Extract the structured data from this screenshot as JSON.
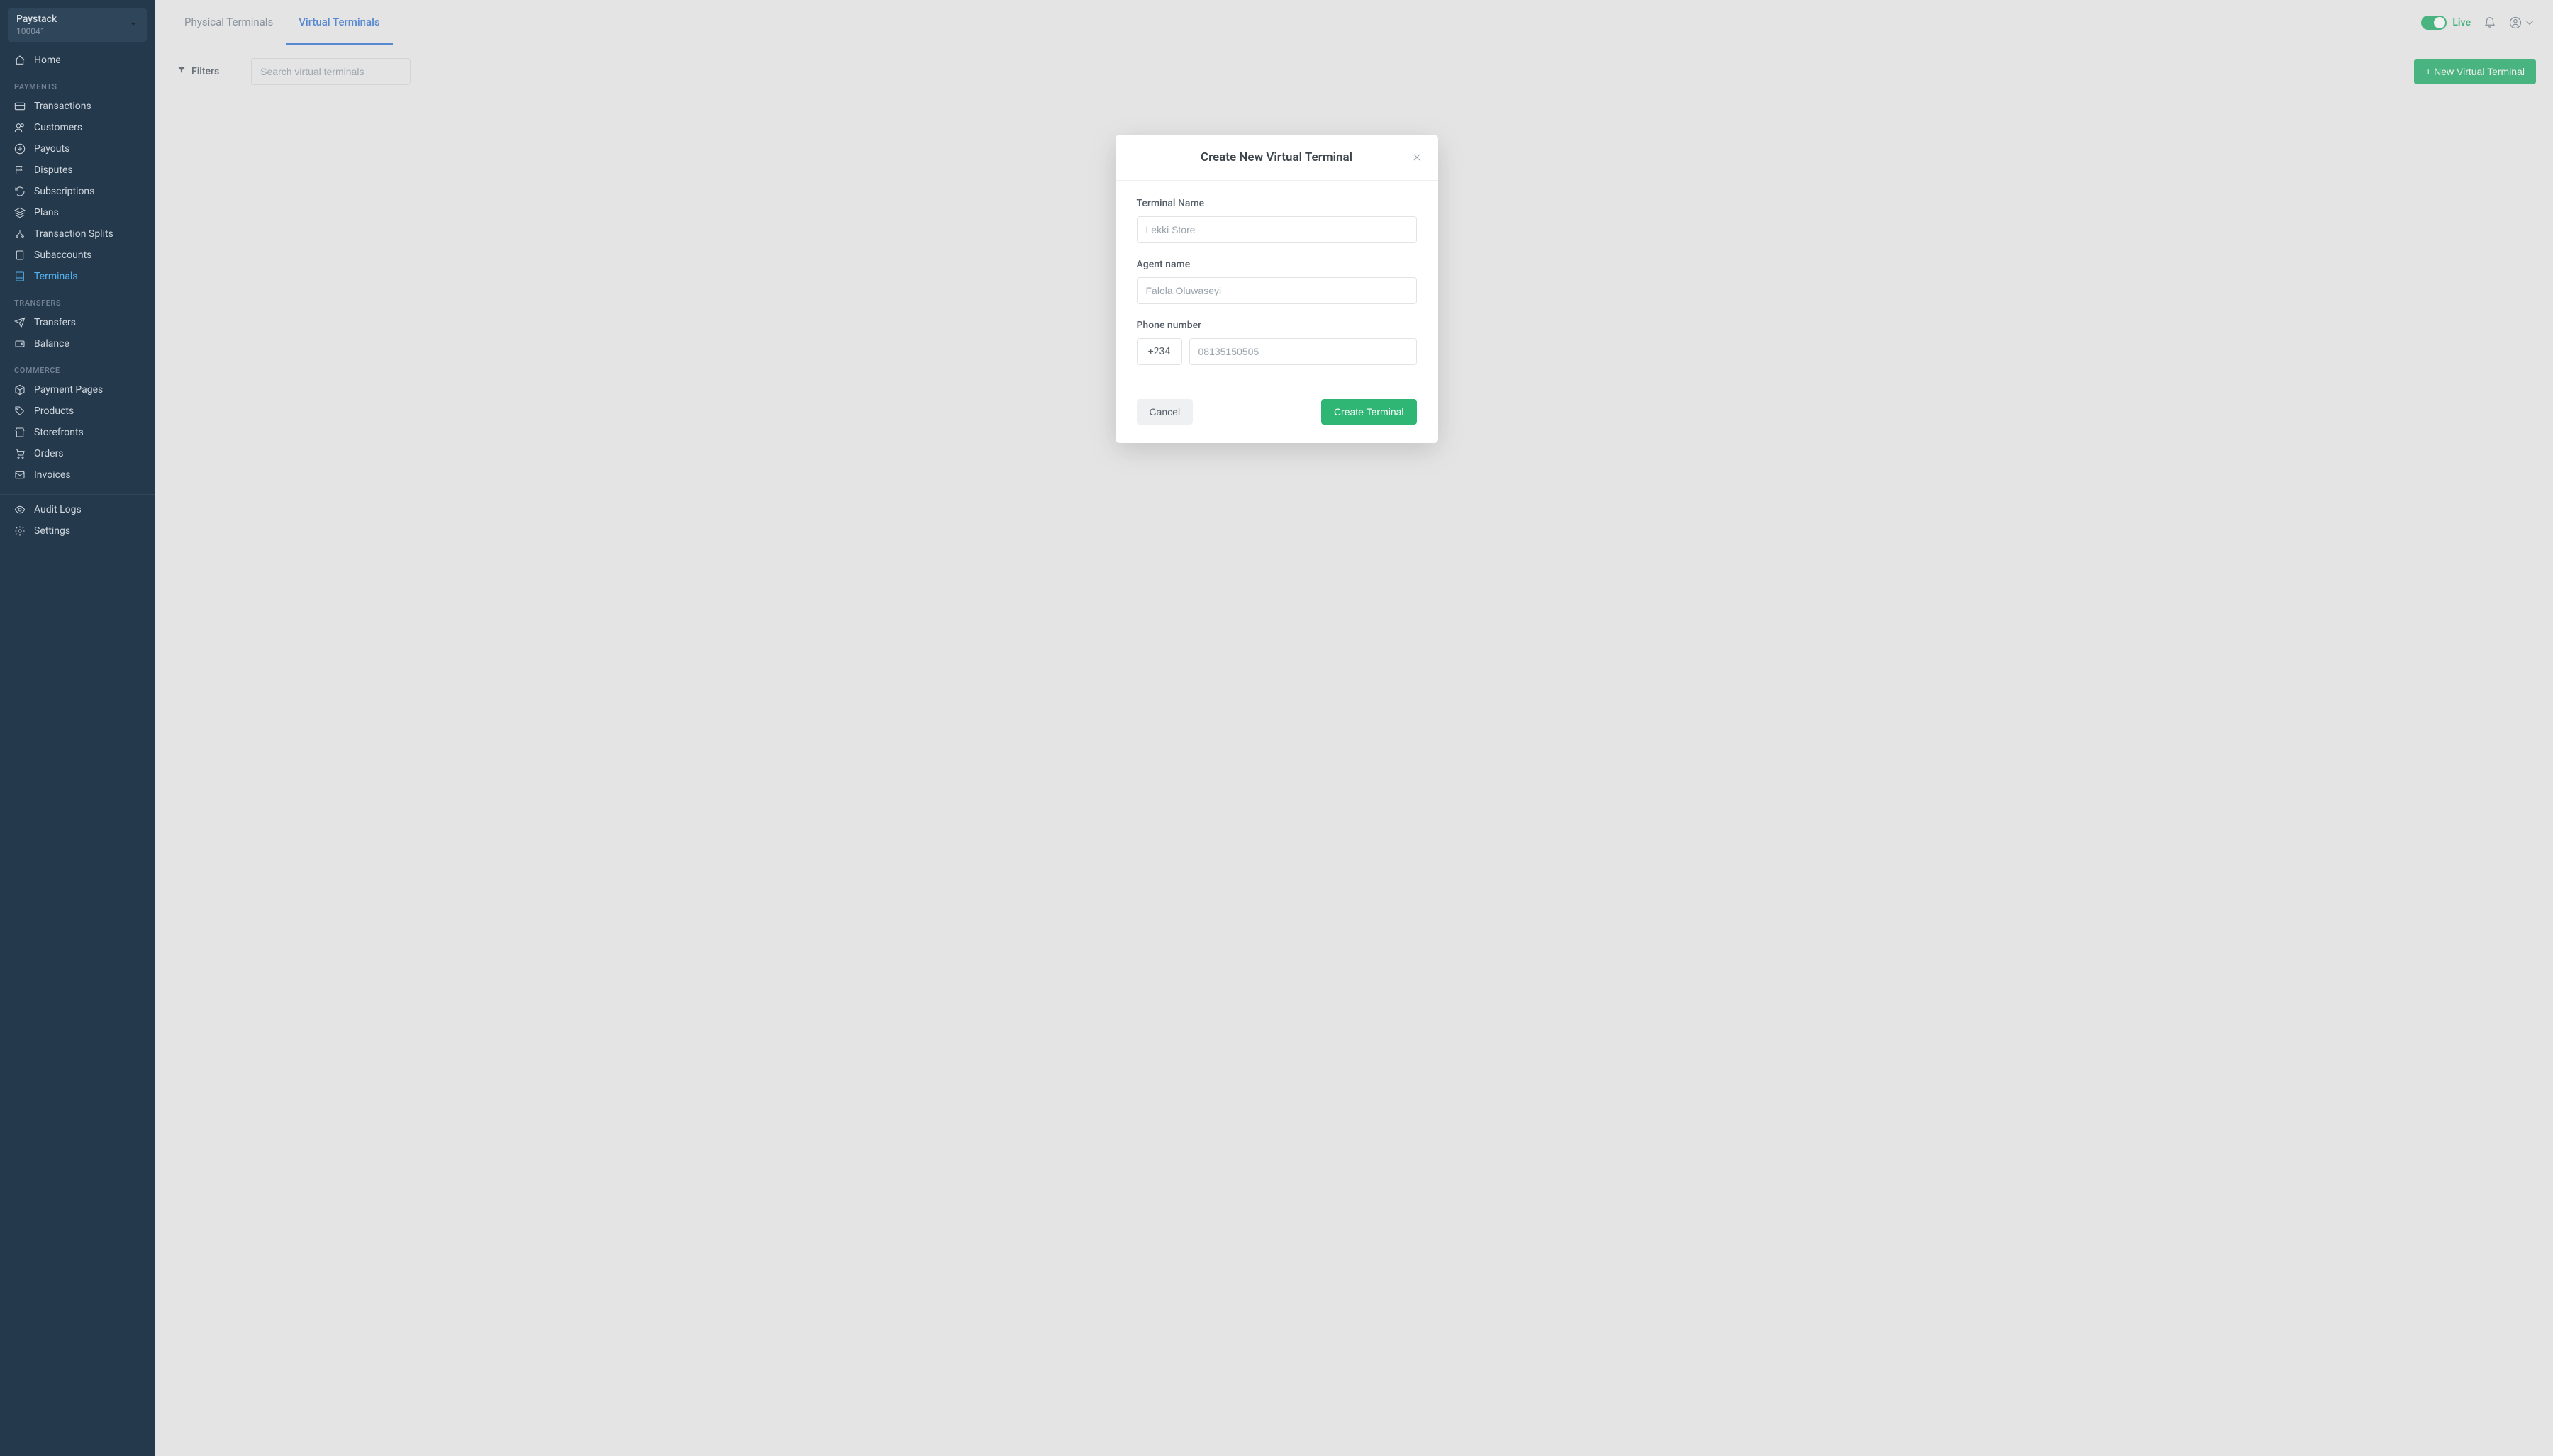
{
  "sidebar": {
    "org_name": "Paystack",
    "org_id": "100041",
    "home_label": "Home",
    "section_payments": "PAYMENTS",
    "section_transfers": "TRANSFERS",
    "section_commerce": "COMMERCE",
    "items": {
      "transactions": "Transactions",
      "customers": "Customers",
      "payouts": "Payouts",
      "disputes": "Disputes",
      "subscriptions": "Subscriptions",
      "plans": "Plans",
      "transaction_splits": "Transaction Splits",
      "subaccounts": "Subaccounts",
      "terminals": "Terminals",
      "transfers": "Transfers",
      "balance": "Balance",
      "payment_pages": "Payment Pages",
      "products": "Products",
      "storefronts": "Storefronts",
      "orders": "Orders",
      "invoices": "Invoices",
      "audit_logs": "Audit Logs",
      "settings": "Settings"
    }
  },
  "tabs": {
    "physical": "Physical Terminals",
    "virtual": "Virtual Terminals"
  },
  "header": {
    "live_label": "Live"
  },
  "toolbar": {
    "filters_label": "Filters",
    "search_placeholder": "Search virtual terminals",
    "new_terminal_label": "+ New Virtual Terminal"
  },
  "modal": {
    "title": "Create New Virtual Terminal",
    "terminal_name_label": "Terminal Name",
    "terminal_name_placeholder": "Lekki Store",
    "agent_name_label": "Agent name",
    "agent_name_placeholder": "Falola Oluwaseyi",
    "phone_label": "Phone number",
    "phone_cc": "+234",
    "phone_placeholder": "08135150505",
    "cancel_label": "Cancel",
    "submit_label": "Create Terminal"
  }
}
